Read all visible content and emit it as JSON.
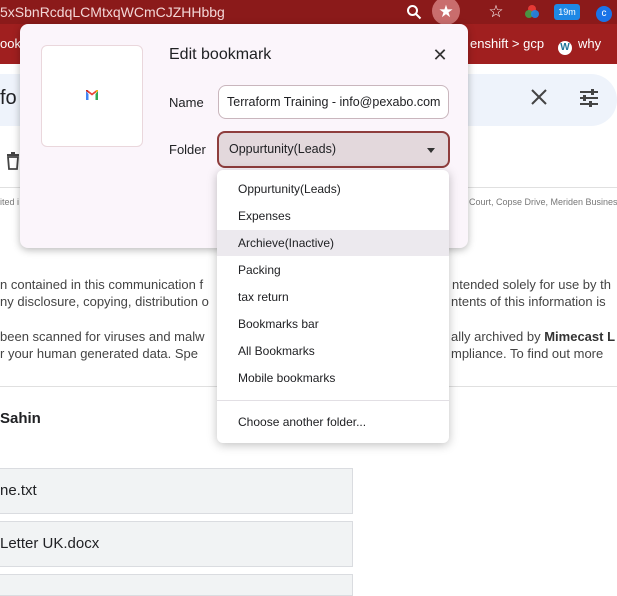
{
  "browser": {
    "url_fragment": "5xSbnRcdqLCMtxqWCmCJZHHbbg",
    "extension_badge": "19m",
    "bookmarks_bar": {
      "left_fragment": "ook",
      "items": [
        {
          "label": "enshift > gcp"
        },
        {
          "label": "why"
        }
      ]
    }
  },
  "page": {
    "search_fragment": "fo",
    "footer_left_fragment": "ited i",
    "footer_right_fragment": "Court, Copse Drive, Meriden Business",
    "disclaimer": {
      "line1_left": "n contained in this communication f",
      "line1_right": "ntended solely for use by th",
      "line2_left": "ny disclosure, copying, distribution o",
      "line2_right": "ntents of this information is",
      "line3_left": "been scanned for viruses and malw",
      "line3_right_plain": "ally archived by ",
      "line3_right_bold": "Mimecast L",
      "line4_left": "r your human generated data. Spe",
      "line4_right": "mpliance. To find out more"
    },
    "sender": "Sahin",
    "attachments": [
      {
        "name": "ne.txt"
      },
      {
        "name": "Letter UK.docx"
      }
    ]
  },
  "dialog": {
    "title": "Edit bookmark",
    "name_label": "Name",
    "name_value": "Terraform Training - info@pexabo.com - Pe",
    "folder_label": "Folder",
    "folder_value": "Oppurtunity(Leads)",
    "folder_options": [
      {
        "label": "Oppurtunity(Leads)"
      },
      {
        "label": "Expenses"
      },
      {
        "label": "Archieve(Inactive)"
      },
      {
        "label": "Packing"
      },
      {
        "label": "tax return"
      },
      {
        "label": "Bookmarks bar"
      },
      {
        "label": "All Bookmarks"
      },
      {
        "label": "Mobile bookmarks"
      }
    ],
    "hovered_option": "Archieve(Inactive)",
    "choose_another": "Choose another folder..."
  },
  "colors": {
    "toolbar": "#8b1a1a",
    "bookmarks_bar": "#a01f1f",
    "dialog_bg": "#fbf5fb",
    "select_border": "#8e3d3d",
    "select_bg": "#e3d8dc"
  }
}
